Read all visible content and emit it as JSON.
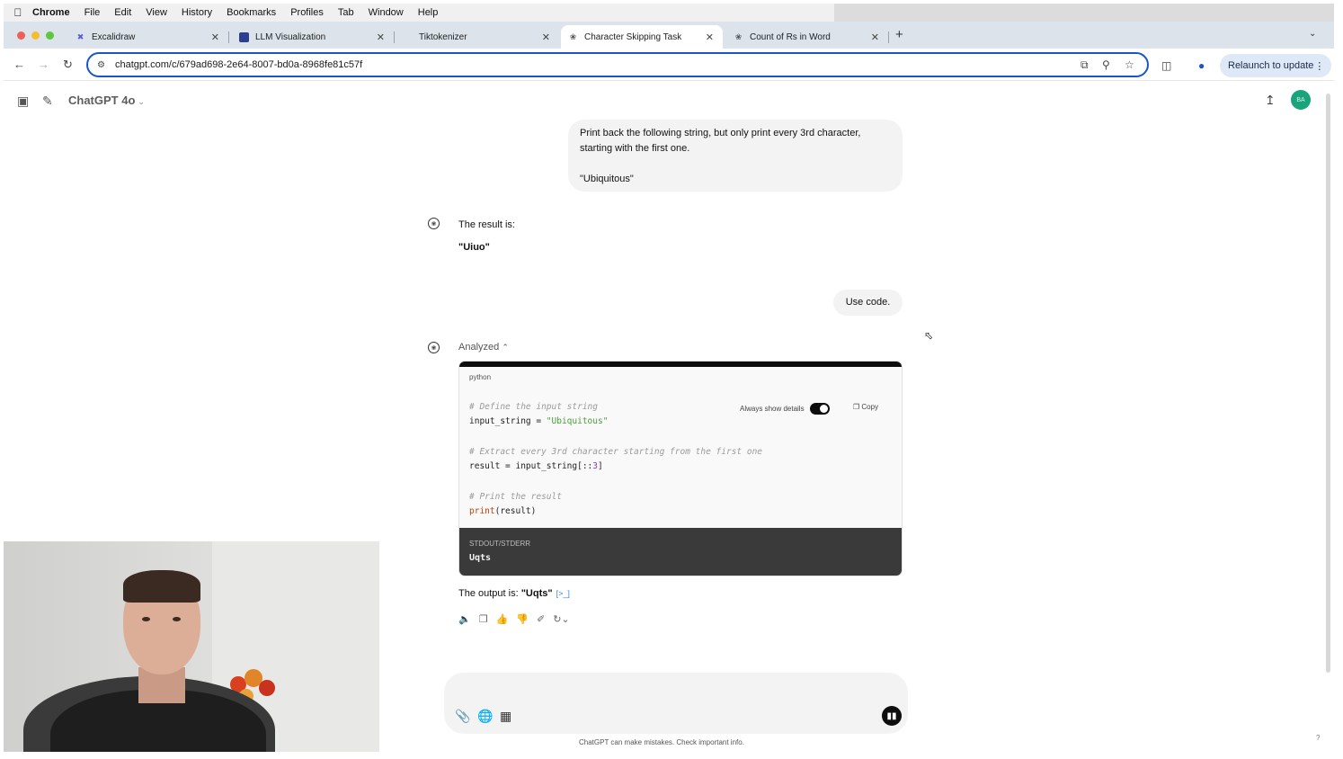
{
  "menubar": {
    "items": [
      "Chrome",
      "File",
      "Edit",
      "View",
      "History",
      "Bookmarks",
      "Profiles",
      "Tab",
      "Window",
      "Help"
    ]
  },
  "tabs": [
    {
      "title": "Excalidraw",
      "icon": "excalidraw-icon",
      "active": false
    },
    {
      "title": "LLM Visualization",
      "icon": "llm-viz-icon",
      "active": false
    },
    {
      "title": "Tiktokenizer",
      "icon": "",
      "active": false
    },
    {
      "title": "Character Skipping Task",
      "icon": "chatgpt-icon",
      "active": true
    },
    {
      "title": "Count of Rs in Word",
      "icon": "chatgpt-icon",
      "active": false
    }
  ],
  "browser": {
    "url": "chatgpt.com/c/679ad698-2e64-8007-bd0a-8968fe81c57f",
    "relaunch_label": "Relaunch to update"
  },
  "header": {
    "model": "ChatGPT 4o",
    "avatar_initials": "BA"
  },
  "messages": {
    "user_1_line1": "Print back the following string, but only print every 3rd character,",
    "user_1_line2": "starting with the first one.",
    "user_1_line3": "\"Ubiquitous\"",
    "assistant_1_intro": "The result is:",
    "assistant_1_result": "\"Uiuo\"",
    "user_2": "Use code.",
    "analyzed_label": "Analyzed",
    "output_prefix": "The output is: ",
    "output_value": "\"Uqts\""
  },
  "code": {
    "language": "python",
    "always_show_details": "Always show details",
    "copy_label": "Copy",
    "lines": [
      {
        "comment": "# Define the input string"
      },
      {
        "pre": "input_string = ",
        "str": "\"Ubiquitous\""
      },
      {
        "comment": "# Extract every 3rd character starting from the first one"
      },
      {
        "pre": "result = input_string[::",
        "num": "3",
        "post": "]"
      },
      {
        "comment": "# Print the result"
      },
      {
        "fn": "print",
        "post": "(result)"
      }
    ],
    "stdout_label": "STDOUT/STDERR",
    "stdout_value": "Uqts"
  },
  "composer": {
    "disclaimer": "ChatGPT can make mistakes. Check important info.",
    "help": "?"
  },
  "colors": {
    "omnibox_border": "#1a56c5",
    "avatar": "#19a47c",
    "code_string": "#4a9a3a",
    "code_function": "#c2410c"
  }
}
